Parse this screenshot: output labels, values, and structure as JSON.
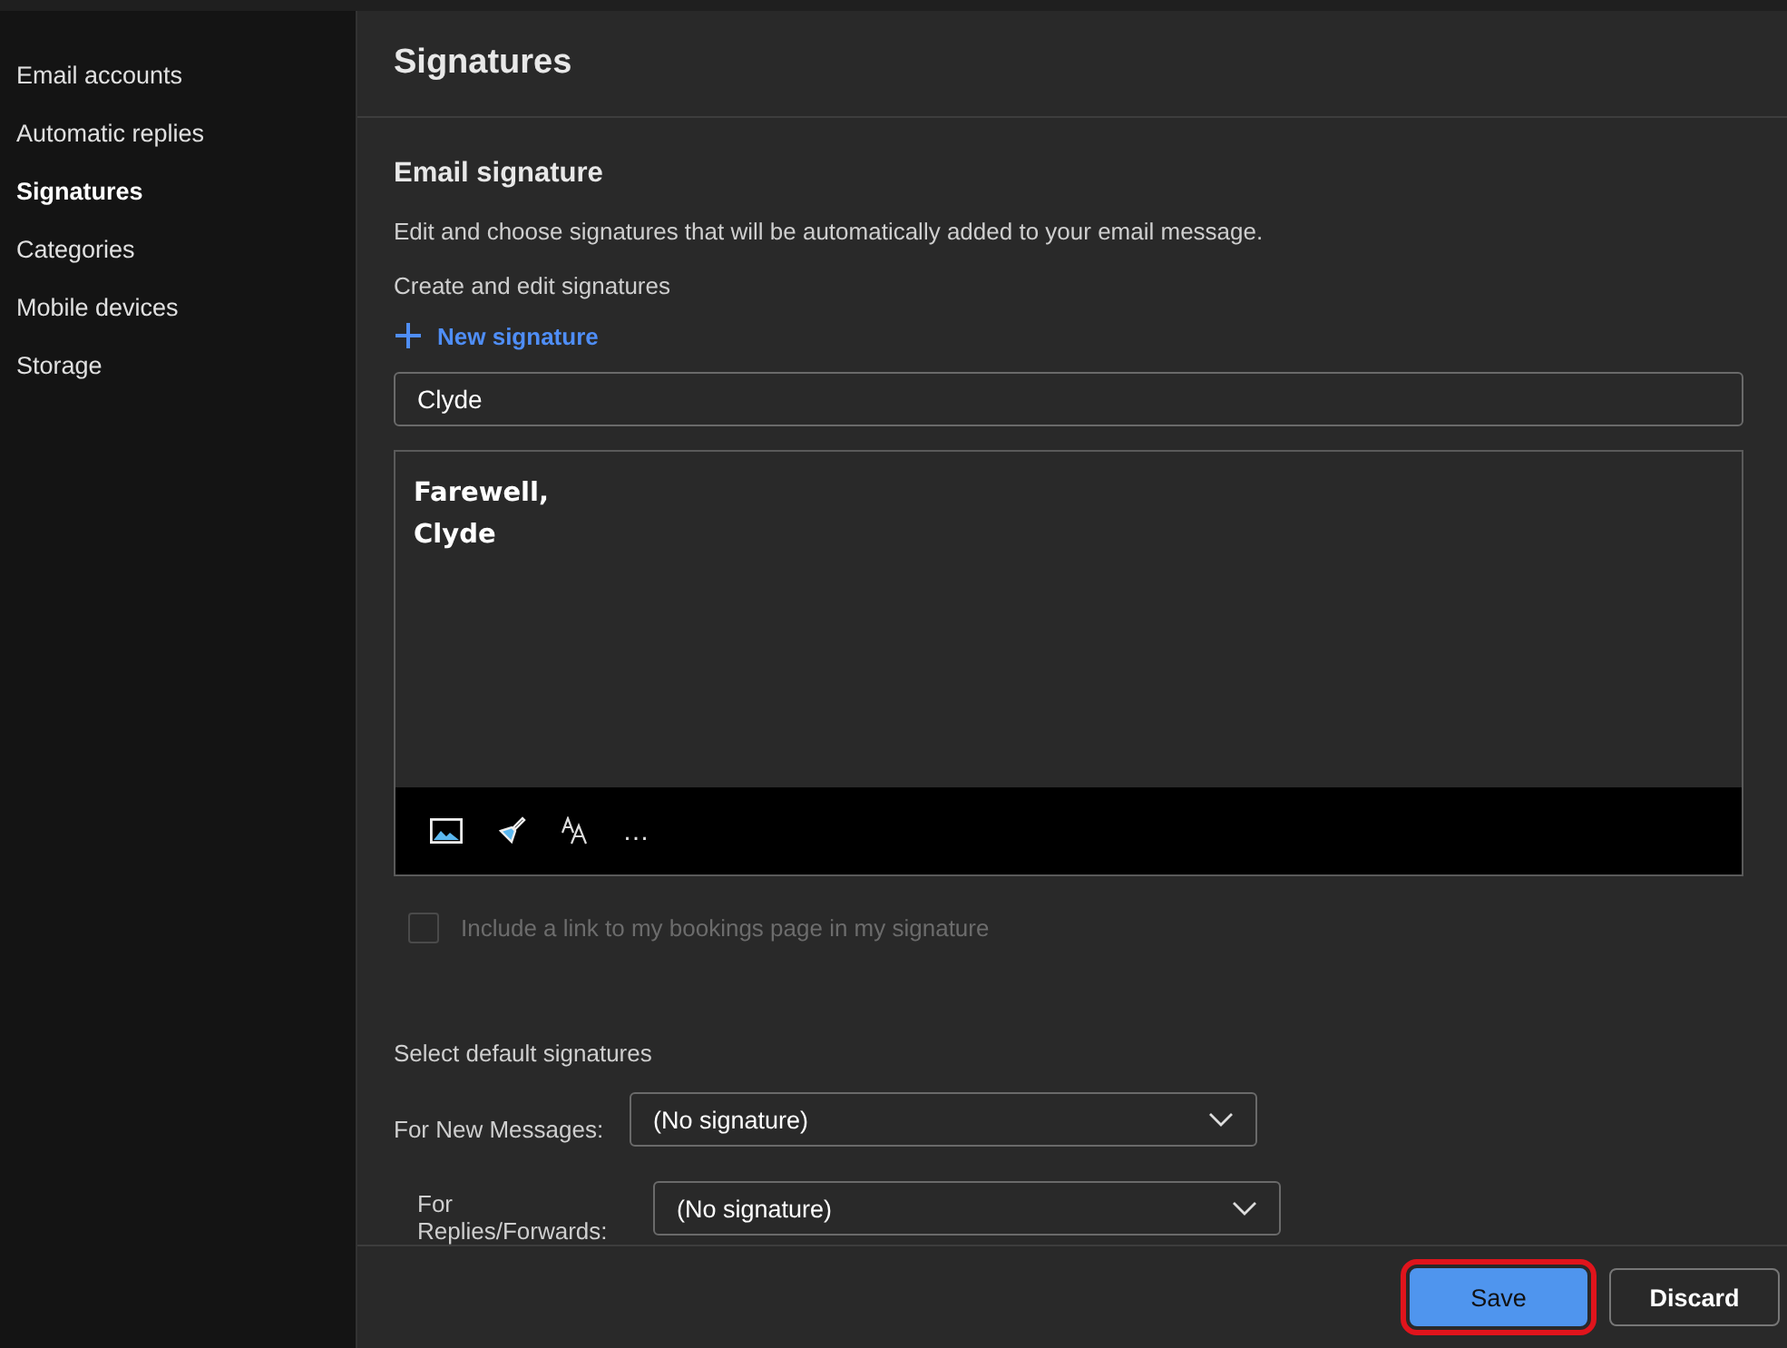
{
  "sidebar": {
    "items": [
      {
        "label": "Email accounts",
        "selected": false
      },
      {
        "label": "Automatic replies",
        "selected": false
      },
      {
        "label": "Signatures",
        "selected": true
      },
      {
        "label": "Categories",
        "selected": false
      },
      {
        "label": "Mobile devices",
        "selected": false
      },
      {
        "label": "Storage",
        "selected": false
      }
    ]
  },
  "page_title": "Signatures",
  "section_title": "Email signature",
  "description": "Edit and choose signatures that will be automatically added to your email message.",
  "create_label": "Create and edit signatures",
  "new_signature": "New signature",
  "signature_name": "Clyde",
  "signature_body": [
    "Farewell,",
    "Clyde"
  ],
  "toolbar": [
    "…"
  ],
  "bookings_checkbox": {
    "label": "Include a link to my bookings page in my signature",
    "checked": false,
    "disabled": true
  },
  "defaults_label": "Select default signatures",
  "defaults": [
    {
      "label": "For New Messages:",
      "value": "(No signature)"
    },
    {
      "label": "For Replies/Forwards:",
      "value": "(No signature)"
    }
  ],
  "buttons": [
    {
      "label": "Save",
      "kind": "primary",
      "highlighted": true
    },
    {
      "label": "Discard",
      "kind": "secondary",
      "highlighted": false
    }
  ]
}
